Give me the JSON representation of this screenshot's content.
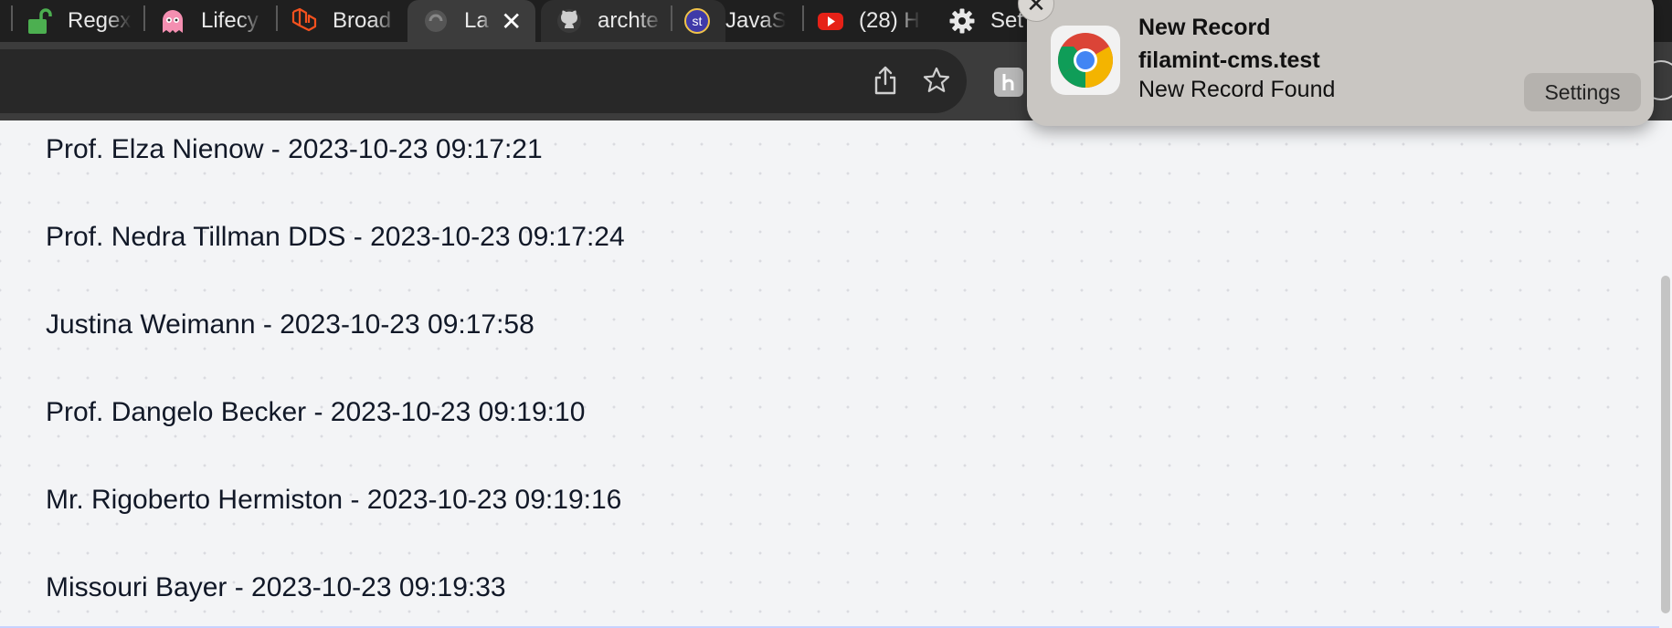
{
  "tabs": [
    {
      "label": "Regex",
      "icon": "unlock-icon"
    },
    {
      "label": "Lifecy",
      "icon": "ghost-icon"
    },
    {
      "label": "Broad",
      "icon": "laravel-icon"
    },
    {
      "label": "La",
      "icon": "loading-icon",
      "active": true
    },
    {
      "label": "archte",
      "icon": "github-icon"
    },
    {
      "label": "JavaS",
      "icon": "st-icon",
      "icon_text": "st"
    },
    {
      "label": "(28) H",
      "icon": "youtube-icon"
    },
    {
      "label": "Set",
      "icon": "gear-icon"
    }
  ],
  "records": [
    "Prof. Elza Nienow - 2023-10-23 09:17:21",
    "Prof. Nedra Tillman DDS - 2023-10-23 09:17:24",
    "Justina Weimann - 2023-10-23 09:17:58",
    "Prof. Dangelo Becker - 2023-10-23 09:19:10",
    "Mr. Rigoberto Hermiston - 2023-10-23 09:19:16",
    "Missouri Bayer - 2023-10-23 09:19:33"
  ],
  "notification": {
    "title": "New Record",
    "site": "filamint-cms.test",
    "body": "New Record Found",
    "settings_label": "Settings",
    "icon": "chrome-icon"
  },
  "colors": {
    "tab_strip": "#1f1f1f",
    "toolbar": "#3c3c3c",
    "content_bg": "#f3f4f6",
    "notification_bg": "#c9c6c2"
  }
}
